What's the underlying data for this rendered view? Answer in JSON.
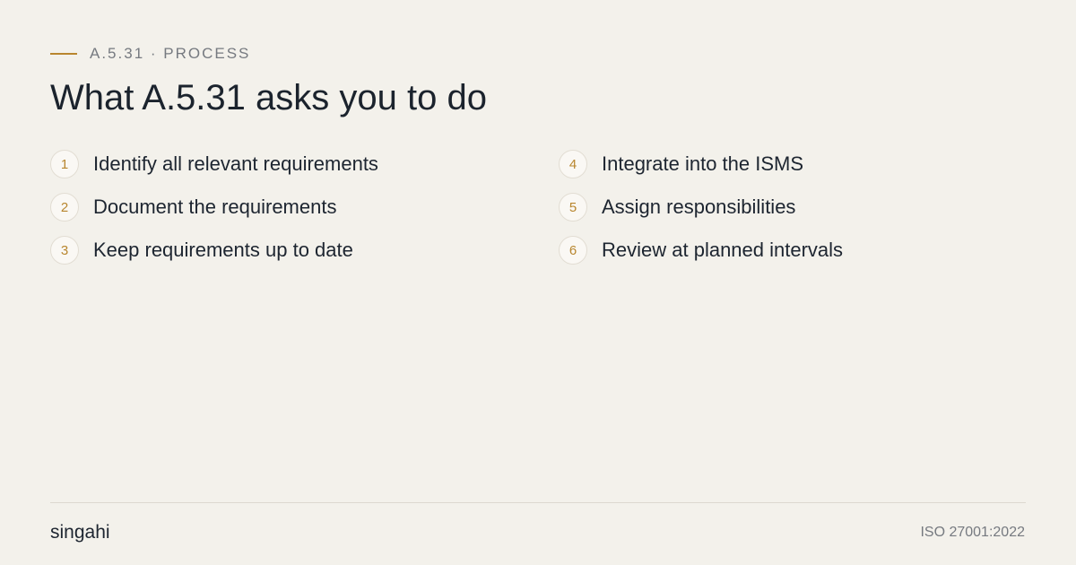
{
  "header": {
    "eyebrow": "A.5.31 · PROCESS",
    "title": "What A.5.31 asks you to do"
  },
  "steps": [
    {
      "number": "1",
      "label": "Identify all relevant requirements"
    },
    {
      "number": "2",
      "label": "Document the requirements"
    },
    {
      "number": "3",
      "label": "Keep requirements up to date"
    },
    {
      "number": "4",
      "label": "Integrate into the ISMS"
    },
    {
      "number": "5",
      "label": "Assign responsibilities"
    },
    {
      "number": "6",
      "label": "Review at planned intervals"
    }
  ],
  "footer": {
    "brand": "singahi",
    "standard": "ISO 27001:2022"
  },
  "colors": {
    "background": "#f3f1eb",
    "accent": "#b8862e",
    "text": "#1d2530",
    "muted": "#767a80"
  }
}
